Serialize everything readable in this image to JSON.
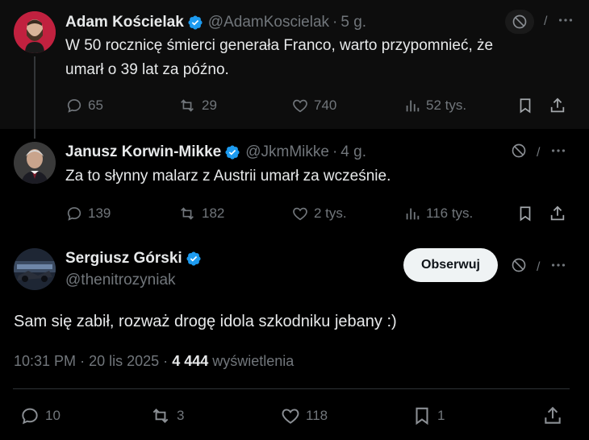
{
  "tweet1": {
    "name": "Adam Kościelak",
    "handle": "@AdamKoscielak",
    "time": "5 g.",
    "text_line1": "W 50 rocznicę śmierci generała Franco, warto przypomnieć, że",
    "text_line2": "umarł o 39 lat za późno.",
    "replies": "65",
    "reposts": "29",
    "likes": "740",
    "views": "52 tys."
  },
  "tweet2": {
    "name": "Janusz Korwin-Mikke",
    "handle": "@JkmMikke",
    "time": "4 g.",
    "text": "Za to słynny malarz z Austrii umarł za wcześnie.",
    "replies": "139",
    "reposts": "182",
    "likes": "2 tys.",
    "views": "116 tys."
  },
  "tweet3": {
    "name": "Sergiusz Górski",
    "handle": "@thenitrozyniak",
    "follow_label": "Obserwuj",
    "text": "Sam się zabił, rozważ drogę idola szkodniku jebany :)",
    "time": "10:31 PM",
    "date": "20 lis 2025",
    "views_count": "4 444",
    "views_label": "wyświetlenia",
    "replies": "10",
    "reposts": "3",
    "likes": "118",
    "bookmarks": "1"
  },
  "separator": "·",
  "colors": {
    "verified": "#1d9bf0",
    "muted": "#71767b",
    "text": "#e7e9ea"
  }
}
